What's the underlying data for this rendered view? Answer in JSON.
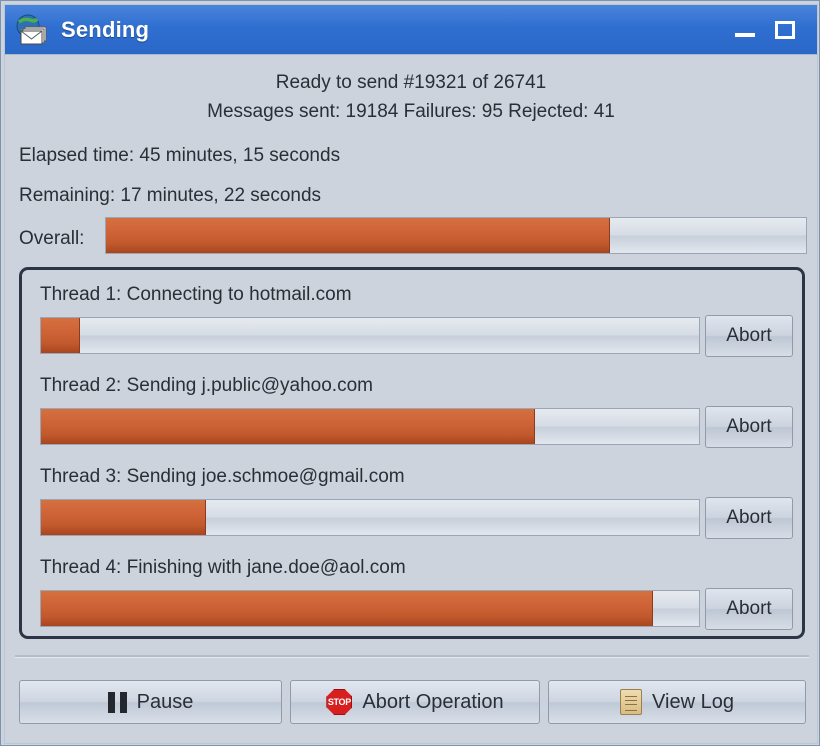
{
  "window": {
    "title": "Sending",
    "app_icon": "mail-globe-icon",
    "minimize_label": "Minimize",
    "maximize_label": "Maximize",
    "title_bar_color": "#2f6fd0",
    "background_color": "#ccd3dc"
  },
  "status": {
    "line1": "Ready to send #19321 of 26741",
    "line2": "Messages sent: 19184  Failures: 95  Rejected: 41",
    "elapsed": "Elapsed time:  45 minutes, 15 seconds",
    "remaining": "Remaining: 17 minutes, 22 seconds"
  },
  "overall": {
    "label": "Overall:",
    "percent": 72,
    "fill_color": "#c85f33"
  },
  "threads": [
    {
      "label": "Thread 1:  Connecting to hotmail.com",
      "percent": 6,
      "abort_label": "Abort"
    },
    {
      "label": "Thread 2:  Sending j.public@yahoo.com",
      "percent": 75,
      "abort_label": "Abort"
    },
    {
      "label": "Thread 3:  Sending joe.schmoe@gmail.com",
      "percent": 25,
      "abort_label": "Abort"
    },
    {
      "label": "Thread 4:  Finishing with jane.doe@aol.com",
      "percent": 93,
      "abort_label": "Abort"
    }
  ],
  "footer": {
    "pause_label": "Pause",
    "pause_icon": "pause-icon",
    "abort_label": "Abort Operation",
    "abort_icon": "stop-sign-icon",
    "abort_icon_text": "STOP",
    "viewlog_label": "View Log",
    "viewlog_icon": "scroll-document-icon"
  }
}
